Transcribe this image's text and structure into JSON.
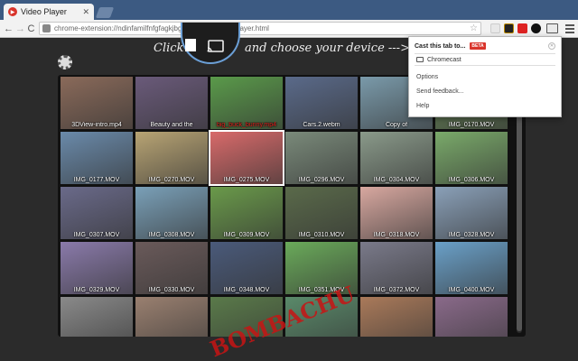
{
  "browser": {
    "tab_title": "Video Player",
    "tab_close": "✕",
    "url": "chrome-extension://ndinfamilfnfgfagkjbgpcdlenhbccjmm/player.html",
    "back": "←",
    "forward": "→",
    "reload": "C",
    "star": "☆"
  },
  "page": {
    "click_text": "Click",
    "choose_text": "and choose your device --->"
  },
  "thumbnails": [
    {
      "caption": "3DView-intro.mp4",
      "color": "#8a6a5a"
    },
    {
      "caption": "Beauty and the",
      "color": "#6a5a7a"
    },
    {
      "caption": "big_buck_bunny.mp4",
      "color": "#5a9a4a"
    },
    {
      "caption": "Cars.2.webm",
      "color": "#5a6a8a"
    },
    {
      "caption": "Copy of",
      "color": "#7a9aaa"
    },
    {
      "caption": "IMG_0170.MOV",
      "color": "#6a8a5a"
    },
    {
      "caption": "IMG_0177.MOV",
      "color": "#6a8aaa"
    },
    {
      "caption": "IMG_0270.MOV",
      "color": "#b8a474"
    },
    {
      "caption": "IMG_0275.MOV",
      "color": "#d86a6a"
    },
    {
      "caption": "IMG_0296.MOV",
      "color": "#7a8a7a"
    },
    {
      "caption": "IMG_0304.MOV",
      "color": "#8a9a8a"
    },
    {
      "caption": "IMG_0306.MOV",
      "color": "#7aaa6a"
    },
    {
      "caption": "IMG_0307.MOV",
      "color": "#6a6a8a"
    },
    {
      "caption": "IMG_0308.MOV",
      "color": "#7aa0b8"
    },
    {
      "caption": "IMG_0309.MOV",
      "color": "#6a9a4a"
    },
    {
      "caption": "IMG_0310.MOV",
      "color": "#5a6a4a"
    },
    {
      "caption": "IMG_0318.MOV",
      "color": "#d8a8a0"
    },
    {
      "caption": "IMG_0328.MOV",
      "color": "#8aa0b8"
    },
    {
      "caption": "IMG_0329.MOV",
      "color": "#8a7aaa"
    },
    {
      "caption": "IMG_0330.MOV",
      "color": "#6a5a5a"
    },
    {
      "caption": "IMG_0348.MOV",
      "color": "#4a5a7a"
    },
    {
      "caption": "IMG_0351.MOV",
      "color": "#6aaa5a"
    },
    {
      "caption": "IMG_0372.MOV",
      "color": "#7a7a8a"
    },
    {
      "caption": "IMG_0400.MOV",
      "color": "#6aa0c8"
    },
    {
      "caption": "",
      "color": "#8a8a8a"
    },
    {
      "caption": "",
      "color": "#9a8070"
    },
    {
      "caption": "",
      "color": "#5a7a4a"
    },
    {
      "caption": "",
      "color": "#5a8a6a"
    },
    {
      "caption": "",
      "color": "#aa7a5a"
    },
    {
      "caption": "",
      "color": "#8a6a8a"
    }
  ],
  "popup": {
    "title": "Cast this tab to...",
    "beta": "BETA",
    "close": "✕",
    "device": "Chromecast",
    "options": "Options",
    "feedback": "Send feedback...",
    "help": "Help"
  },
  "watermark": "BOMBACHU"
}
